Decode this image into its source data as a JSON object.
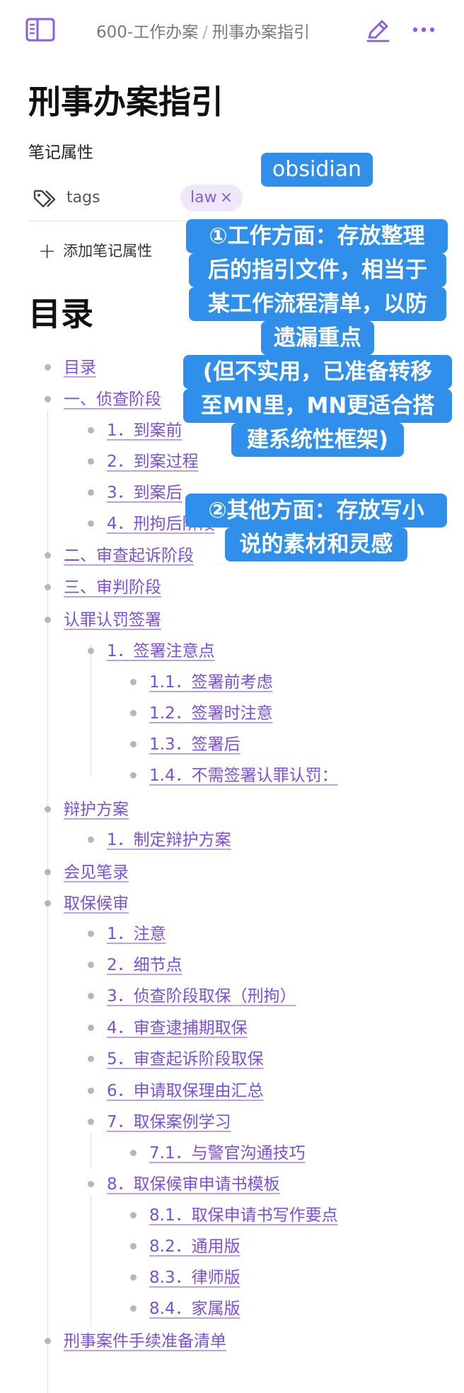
{
  "header": {
    "breadcrumb_folder": "600-工作办案",
    "breadcrumb_separator": "/",
    "breadcrumb_note": "刑事办案指引"
  },
  "note": {
    "title": "刑事办案指引",
    "properties_heading": "笔记属性",
    "property_key": "tags",
    "tag_value": "law",
    "tag_remove": "×",
    "add_property": "添加笔记属性",
    "toc_heading": "目录"
  },
  "toc": [
    {
      "label": "目录"
    },
    {
      "label": "一、侦查阶段"
    },
    {
      "label": "1．到案前"
    },
    {
      "label": "2．到案过程"
    },
    {
      "label": "3．到案后"
    },
    {
      "label": "4．刑拘后阶段"
    },
    {
      "label": "二、审查起诉阶段"
    },
    {
      "label": "三、审判阶段"
    },
    {
      "label": "认罪认罚签署"
    },
    {
      "label": "1．签署注意点"
    },
    {
      "label": "1.1．签署前考虑"
    },
    {
      "label": "1.2．签署时注意"
    },
    {
      "label": "1.3．签署后"
    },
    {
      "label": "1.4．不需签署认罪认罚："
    },
    {
      "label": "辩护方案"
    },
    {
      "label": "1．制定辩护方案"
    },
    {
      "label": "会见笔录"
    },
    {
      "label": "取保候审"
    },
    {
      "label": "1．注意"
    },
    {
      "label": "2．细节点"
    },
    {
      "label": "3．侦查阶段取保（刑拘）"
    },
    {
      "label": "4．审查逮捕期取保"
    },
    {
      "label": "5．审查起诉阶段取保"
    },
    {
      "label": "6．申请取保理由汇总"
    },
    {
      "label": "7．取保案例学习"
    },
    {
      "label": "7.1．与警官沟通技巧"
    },
    {
      "label": "8．取保候审申请书模板"
    },
    {
      "label": "8.1．取保申请书写作要点"
    },
    {
      "label": "8.2．通用版"
    },
    {
      "label": "8.3．律师版"
    },
    {
      "label": "8.4．家属版"
    },
    {
      "label": "刑事案件手续准备清单"
    }
  ],
  "annotation": {
    "badge": "obsidian",
    "point1_lines": [
      "①工作方面：存放整理",
      "后的指引文件，相当于",
      "某工作流程清单，以防",
      "遗漏重点",
      "(但不实用，已准备转移",
      "至MN里，MN更适合搭",
      "建系统性框架)"
    ],
    "point2_lines": [
      "②其他方面：存放写小",
      "说的素材和灵感"
    ]
  },
  "colors": {
    "accent": "#7b4fe0",
    "tag_bg": "#efe8fb",
    "callout_bg": "#2f8fea"
  },
  "icons": [
    "sidebar-toggle-icon",
    "edit-pencil-icon",
    "more-dots-icon",
    "tag-icon",
    "plus-icon"
  ]
}
